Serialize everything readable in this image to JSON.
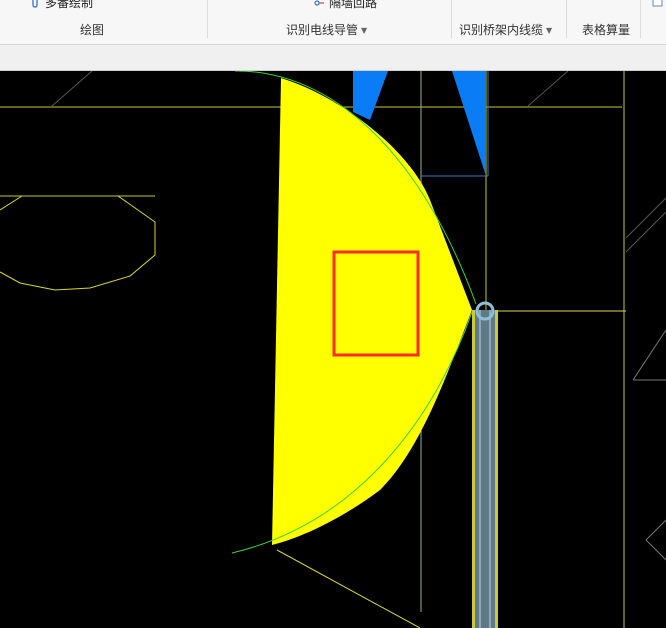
{
  "ribbon": {
    "top_left_label": "多番绘制",
    "top_mid_label": "隔墙回路",
    "top_right_icon": "document-icon",
    "groups": [
      {
        "label": "绘图",
        "has_dropdown": false
      },
      {
        "label": "识别电线导管",
        "has_dropdown": true
      },
      {
        "label": "识别桥架内线缆",
        "has_dropdown": true
      },
      {
        "label": "表格算量",
        "has_dropdown": false
      }
    ]
  },
  "colors": {
    "background": "#000000",
    "selection_fill": "#ffff00",
    "outline": "#ffff00",
    "highlight_box": "#ff2a2a",
    "fill_blue": "#0a7cf5",
    "pipe": "#5f7a86",
    "green_arc": "#39d23a"
  }
}
